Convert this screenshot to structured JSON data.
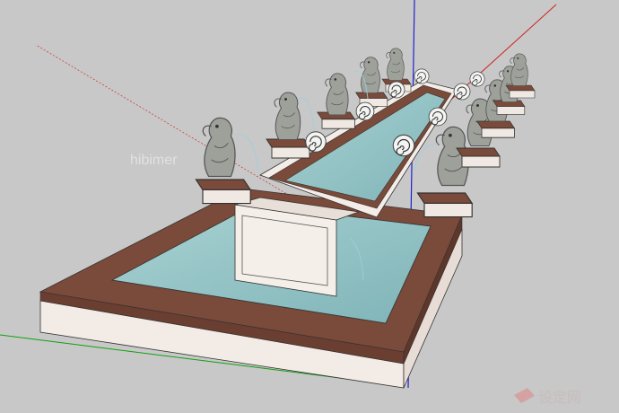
{
  "watermark": {
    "text": "hibimer"
  },
  "brand": {
    "name": "设定网",
    "logo_icon": "pink-diamond-mark-icon",
    "color": "#c8c0c0"
  },
  "colors": {
    "background": "#c8c8c8",
    "coping": "#7a4a3a",
    "wall": "#f4ece6",
    "water": "#8ec0c2",
    "stone": "#9a9e98",
    "axis_red": "#d02020",
    "axis_green": "#10a010",
    "axis_blue": "#2020d0"
  }
}
